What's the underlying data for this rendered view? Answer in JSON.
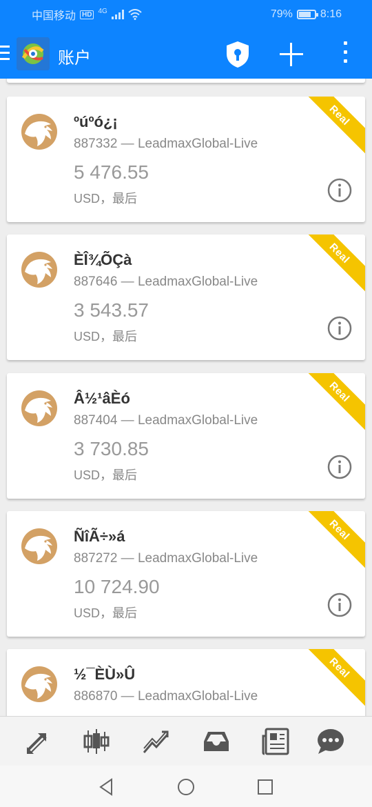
{
  "status_bar": {
    "carrier": "中国移动",
    "hd": "HD",
    "network": "4G",
    "battery": "79%",
    "battery_level": 0.79,
    "time": "8:16"
  },
  "app_bar": {
    "title": "账户",
    "icons": [
      "menu-icon",
      "app-logo",
      "shield-lock-icon",
      "plus-icon",
      "more-vert-icon"
    ]
  },
  "accounts": [
    {
      "name": "ºúºó¿¡",
      "number_server": "887332 — LeadmaxGlobal-Live",
      "balance": "5 476.55",
      "status": "USD，最后",
      "badge": "Real"
    },
    {
      "name": "ÈÎ¾ÕÇà",
      "number_server": "887646 — LeadmaxGlobal-Live",
      "balance": "3 543.57",
      "status": "USD，最后",
      "badge": "Real"
    },
    {
      "name": "Â½¹âÈó",
      "number_server": "887404 — LeadmaxGlobal-Live",
      "balance": "3 730.85",
      "status": "USD，最后",
      "badge": "Real"
    },
    {
      "name": "ÑîÃ÷»á",
      "number_server": "887272 — LeadmaxGlobal-Live",
      "balance": "10 724.90",
      "status": "USD，最后",
      "badge": "Real"
    },
    {
      "name": "½¯ÈÙ»Û",
      "number_server": "886870 — LeadmaxGlobal-Live",
      "balance": "",
      "status": "",
      "badge": "Real"
    }
  ],
  "bottom_nav": [
    "quotes-arrows-icon",
    "candlestick-chart-icon",
    "trend-chart-icon",
    "inbox-tray-icon",
    "news-icon",
    "chat-bubble-icon"
  ],
  "system_nav": [
    "back-icon",
    "home-icon",
    "recents-icon"
  ],
  "colors": {
    "primary": "#0d84ff",
    "ribbon": "#f5c400",
    "avatar": "#d3a165"
  }
}
